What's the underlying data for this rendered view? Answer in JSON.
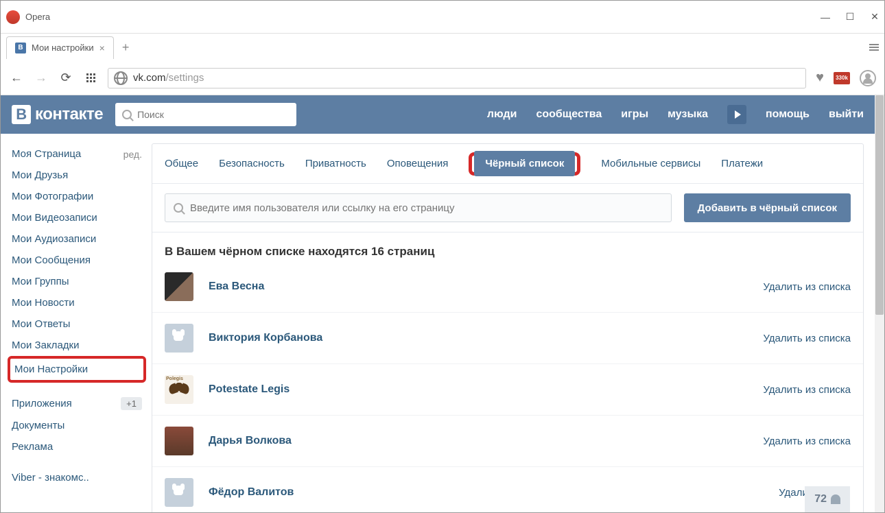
{
  "browser": {
    "name": "Opera",
    "win_min": "—",
    "win_max": "☐",
    "win_close": "✕",
    "tab_title": "Мои настройки",
    "new_tab": "+",
    "url_host": "vk.com",
    "url_path": "/settings",
    "ext_badge": "330k"
  },
  "vk_header": {
    "logo_text": "контакте",
    "logo_letter": "В",
    "search_placeholder": "Поиск",
    "nav": [
      "люди",
      "сообщества",
      "игры",
      "музыка"
    ],
    "help": "помощь",
    "logout": "выйти"
  },
  "sidebar": {
    "items": [
      {
        "label": "Моя Страница",
        "sub": "ред."
      },
      {
        "label": "Мои Друзья"
      },
      {
        "label": "Мои Фотографии"
      },
      {
        "label": "Мои Видеозаписи"
      },
      {
        "label": "Мои Аудиозаписи"
      },
      {
        "label": "Мои Сообщения"
      },
      {
        "label": "Мои Группы"
      },
      {
        "label": "Мои Новости"
      },
      {
        "label": "Мои Ответы"
      },
      {
        "label": "Мои Закладки"
      },
      {
        "label": "Мои Настройки",
        "highlight": true
      }
    ],
    "extra": [
      {
        "label": "Приложения",
        "badge": "+1"
      },
      {
        "label": "Документы"
      },
      {
        "label": "Реклама"
      }
    ],
    "bottom": [
      {
        "label": "Viber - знакомс.."
      }
    ]
  },
  "tabs": [
    "Общее",
    "Безопасность",
    "Приватность",
    "Оповещения",
    "Чёрный список",
    "Мобильные сервисы",
    "Платежи"
  ],
  "active_tab_index": 4,
  "blacklist": {
    "search_placeholder": "Введите имя пользователя или ссылку на его страницу",
    "add_button": "Добавить в чёрный список",
    "title": "В Вашем чёрном списке находятся 16 страниц",
    "remove_label": "Удалить из списка",
    "remove_label_cut": "Удалить из спи",
    "users": [
      {
        "name": "Ева Весна",
        "avatar": "photo1"
      },
      {
        "name": "Виктория Корбанова",
        "avatar": "default"
      },
      {
        "name": "Potestate Legis",
        "avatar": "photo3",
        "polegis": "Polegis"
      },
      {
        "name": "Дарья Волкова",
        "avatar": "photo4"
      },
      {
        "name": "Фёдор Валитов",
        "avatar": "default"
      }
    ]
  },
  "counter": "72"
}
